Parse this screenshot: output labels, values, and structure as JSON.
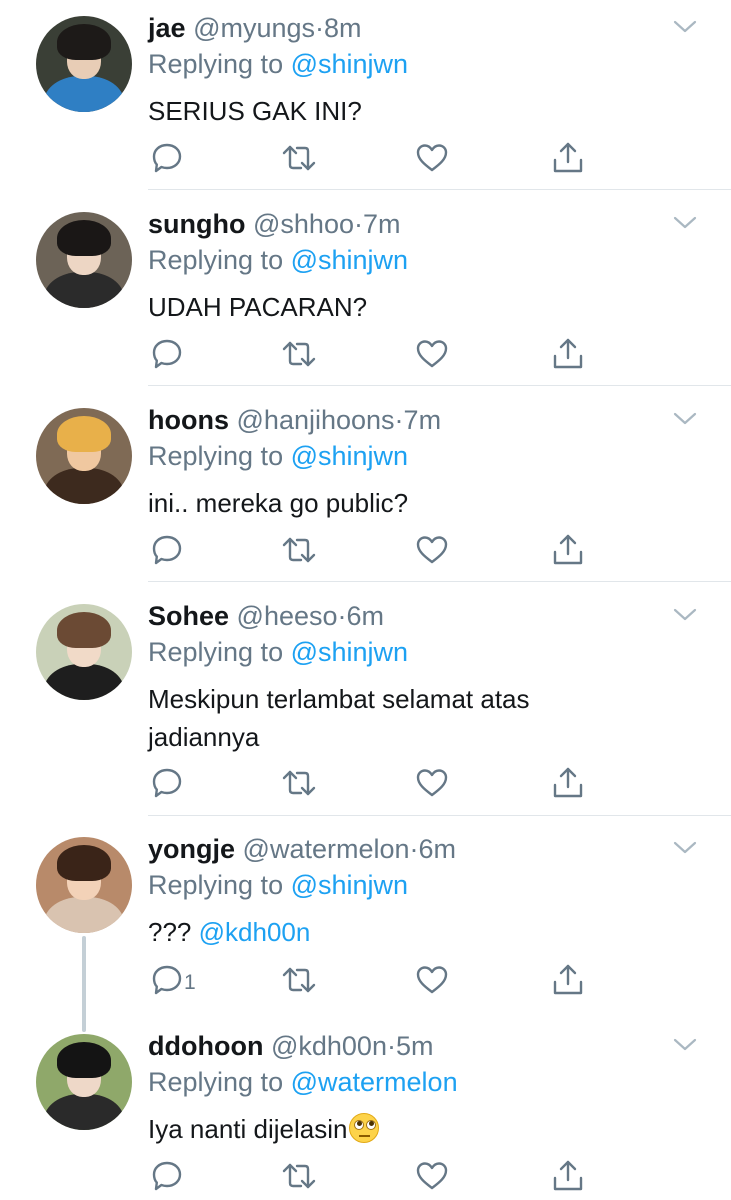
{
  "colors": {
    "text": "#14171a",
    "secondary": "#657786",
    "link": "#1da1f2",
    "divider": "#e1e6ea",
    "thread_line": "#c4cfd6"
  },
  "icons": {
    "reply": "speech-bubble-icon",
    "retweet": "retweet-arrows-icon",
    "like": "heart-outline-icon",
    "share": "share-upload-icon",
    "more": "chevron-down-icon"
  },
  "tweets": [
    {
      "name": "jae",
      "handle": "@myungs",
      "sep": "·",
      "time": "8m",
      "reply_prefix": "Replying to",
      "reply_to": "@shinjwn",
      "text": "SERIUS GAK INI?",
      "reply_count": ""
    },
    {
      "name": "sungho",
      "handle": "@shhoo",
      "sep": "·",
      "time": "7m",
      "reply_prefix": "Replying to",
      "reply_to": "@shinjwn",
      "text": "UDAH PACARAN?",
      "reply_count": ""
    },
    {
      "name": "hoons",
      "handle": "@hanjihoons",
      "sep": "·",
      "time": "7m",
      "reply_prefix": "Replying to",
      "reply_to": "@shinjwn",
      "text": "ini.. mereka go public?",
      "reply_count": ""
    },
    {
      "name": "Sohee",
      "handle": "@heeso",
      "sep": "·",
      "time": "6m",
      "reply_prefix": "Replying to",
      "reply_to": "@shinjwn",
      "text": "Meskipun terlambat selamat atas jadiannya",
      "reply_count": ""
    },
    {
      "name": "yongje",
      "handle": "@watermelon",
      "sep": "·",
      "time": "6m",
      "reply_prefix": "Replying to",
      "reply_to": "@shinjwn",
      "text": "???",
      "text_mention": "@kdh00n",
      "reply_count": "1"
    },
    {
      "name": "ddohoon",
      "handle": "@kdh00n",
      "sep": "·",
      "time": "5m",
      "reply_prefix": "Replying to",
      "reply_to": "@watermelon",
      "text": "Iya nanti dijelasin",
      "emoji": "face-with-rolling-eyes",
      "reply_count": ""
    }
  ]
}
